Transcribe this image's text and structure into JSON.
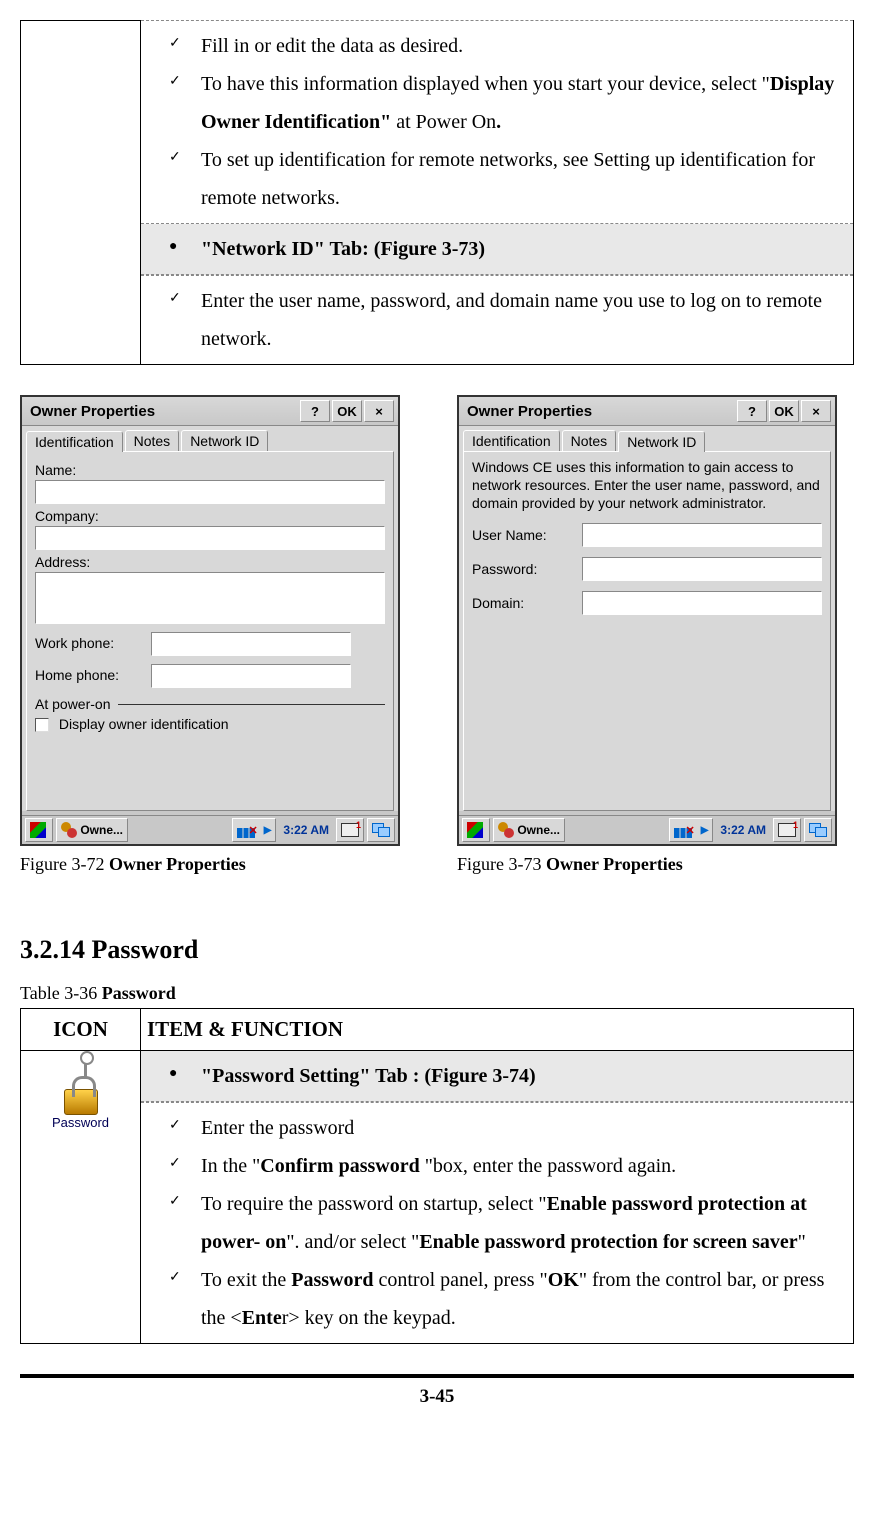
{
  "table1": {
    "checks1": [
      {
        "parts": [
          {
            "t": "Fill in or edit the data as desired."
          }
        ]
      },
      {
        "parts": [
          {
            "t": "To have this information displayed when you start your device, select \""
          },
          {
            "t": "Display Owner Identification\"",
            "b": true
          },
          {
            "t": " at Power On"
          },
          {
            "t": ".",
            "b": true
          }
        ]
      },
      {
        "parts": [
          {
            "t": "To set up identification for remote networks, see Setting up identification for remote networks."
          }
        ]
      }
    ],
    "bullet2": "\"Network ID\" Tab: (Figure 3-73)",
    "checks2": [
      {
        "parts": [
          {
            "t": "Enter the user name, password, and domain name you use to log on to remote network."
          }
        ]
      }
    ]
  },
  "dialog1": {
    "title": "Owner Properties",
    "help": "?",
    "ok": "OK",
    "close": "×",
    "tabs": [
      "Identification",
      "Notes",
      "Network ID"
    ],
    "activeTab": 0,
    "labels": {
      "name": "Name:",
      "company": "Company:",
      "address": "Address:",
      "work": "Work phone:",
      "home": "Home phone:",
      "poweron": "At power-on",
      "display": "Display owner identification"
    },
    "taskbar": {
      "app": "Owne...",
      "time": "3:22 AM"
    }
  },
  "dialog2": {
    "title": "Owner Properties",
    "help": "?",
    "ok": "OK",
    "close": "×",
    "tabs": [
      "Identification",
      "Notes",
      "Network ID"
    ],
    "activeTab": 2,
    "info": "Windows CE uses this information to gain access to network resources. Enter the user name, password, and domain provided by your network administrator.",
    "labels": {
      "user": "User Name:",
      "pass": "Password:",
      "domain": "Domain:"
    },
    "taskbar": {
      "app": "Owne...",
      "time": "3:22 AM"
    }
  },
  "figcap1": {
    "pre": "Figure 3-72 ",
    "b": "Owner Properties"
  },
  "figcap2": {
    "pre": "Figure 3-73 ",
    "b": "Owner Properties"
  },
  "sectionHeading": "3.2.14 Password",
  "table2caption": {
    "pre": "Table 3-36 ",
    "b": "Password"
  },
  "table2": {
    "hdrIcon": "ICON",
    "hdrFunc": "ITEM & FUNCTION",
    "iconLabel": "Password",
    "bullet": [
      {
        "t": "\""
      },
      {
        "t": "Password Setting",
        "b": true
      },
      {
        "t": "\" "
      },
      {
        "t": "Tab",
        "b": true
      },
      {
        "t": " : ("
      },
      {
        "t": "Figure 3-74",
        "b": true
      },
      {
        "t": ")"
      }
    ],
    "checks": [
      {
        "parts": [
          {
            "t": "Enter the password"
          }
        ]
      },
      {
        "parts": [
          {
            "t": "In the \""
          },
          {
            "t": "Confirm password ",
            "b": true
          },
          {
            "t": "\"box, enter the password again."
          }
        ]
      },
      {
        "parts": [
          {
            "t": "To require the password on startup, select \""
          },
          {
            "t": "Enable password protection at power- on",
            "b": true
          },
          {
            "t": "\". and/or select \""
          },
          {
            "t": "Enable password protection for screen saver",
            "b": true
          },
          {
            "t": "\""
          }
        ]
      },
      {
        "parts": [
          {
            "t": "To exit the "
          },
          {
            "t": "Password",
            "b": true
          },
          {
            "t": " control panel, press \""
          },
          {
            "t": "OK",
            "b": true
          },
          {
            "t": "\" from the control bar, or press the <"
          },
          {
            "t": "Ente",
            "b": true
          },
          {
            "t": "r> key on the keypad."
          }
        ]
      }
    ]
  },
  "pageNum": "3-45"
}
